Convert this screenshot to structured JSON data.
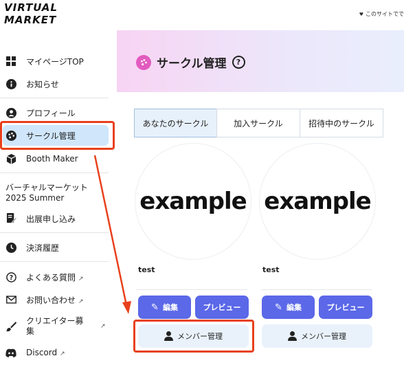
{
  "logo": {
    "line1": "VIRTUAL",
    "line2": "MARKET"
  },
  "top_note": "このサイトでで",
  "sidebar": {
    "items": [
      {
        "label": "マイページTOP",
        "icon": "grid-icon"
      },
      {
        "label": "お知らせ",
        "icon": "info-icon"
      },
      {
        "label": "プロフィール",
        "icon": "user-circle-icon"
      },
      {
        "label": "サークル管理",
        "icon": "palette-icon"
      },
      {
        "label": "Booth Maker",
        "icon": "box-icon"
      },
      {
        "label": "出展申し込み",
        "icon": "edit-document-icon"
      },
      {
        "label": "決済履歴",
        "icon": "clock-icon"
      },
      {
        "label": "よくある質問",
        "icon": "question-icon"
      },
      {
        "label": "お問い合わせ",
        "icon": "mail-icon"
      },
      {
        "label": "クリエイター募集",
        "icon": "brush-icon"
      },
      {
        "label": "Discord",
        "icon": "discord-icon"
      }
    ],
    "section_line1": "バーチャルマーケット",
    "section_line2": "2025 Summer"
  },
  "main": {
    "title": "サークル管理",
    "tabs": [
      {
        "label": "あなたのサークル"
      },
      {
        "label": "加入サークル"
      },
      {
        "label": "招待中のサークル"
      }
    ],
    "cards": [
      {
        "image_text": "example",
        "name": "test",
        "edit_label": "編集",
        "preview_label": "プレビュー",
        "member_label": "メンバー管理"
      },
      {
        "image_text": "example",
        "name": "test",
        "edit_label": "編集",
        "preview_label": "プレビュー",
        "member_label": "メンバー管理"
      }
    ]
  },
  "colors": {
    "accent": "#5b68e8",
    "highlight": "#e8401c",
    "active_bg": "#cfe6fb",
    "title_icon": "#e25bbf"
  }
}
